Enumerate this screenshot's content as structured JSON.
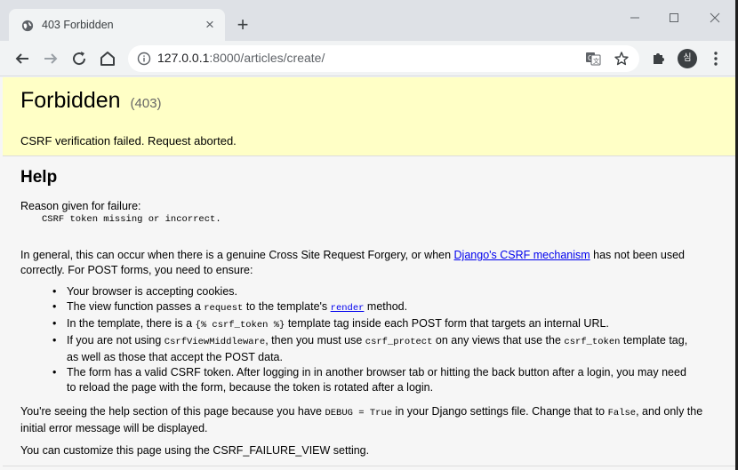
{
  "tab": {
    "title": "403 Forbidden",
    "close_glyph": "×"
  },
  "toolbar": {
    "url_host": "127.0.0.1",
    "url_rest": ":8000/articles/create/",
    "avatar_text": "심"
  },
  "summary": {
    "title": "Forbidden",
    "code": "(403)",
    "message": "CSRF verification failed. Request aborted."
  },
  "help": {
    "title": "Help",
    "reason_label": "Reason given for failure:",
    "reason_code": "CSRF token missing or incorrect.",
    "intro_before_link": "In general, this can occur when there is a genuine Cross Site Request Forgery, or when ",
    "intro_link": "Django's CSRF mechanism",
    "intro_after_link": " has not been used correctly. For POST forms, you need to ensure:",
    "items": [
      {
        "text": "Your browser is accepting cookies."
      },
      {
        "a": "The view function passes a ",
        "code1": "request",
        "b": " to the template's ",
        "link": "render",
        "c": " method."
      },
      {
        "a": "In the template, there is a ",
        "code1": "{% csrf_token %}",
        "b": " template tag inside each POST form that targets an internal URL."
      },
      {
        "a": "If you are not using ",
        "code1": "CsrfViewMiddleware",
        "b": ", then you must use ",
        "code2": "csrf_protect",
        "c": " on any views that use the ",
        "code3": "csrf_token",
        "d": " template tag, as well as those that accept the POST data."
      },
      {
        "text": "The form has a valid CSRF token. After logging in in another browser tab or hitting the back button after a login, you may need to reload the page with the form, because the token is rotated after a login."
      }
    ],
    "debug_a": "You're seeing the help section of this page because you have ",
    "debug_code1": "DEBUG = True",
    "debug_b": " in your Django settings file. Change that to ",
    "debug_code2": "False",
    "debug_c": ", and only the initial error message will be displayed.",
    "customize": "You can customize this page using the CSRF_FAILURE_VIEW setting."
  }
}
